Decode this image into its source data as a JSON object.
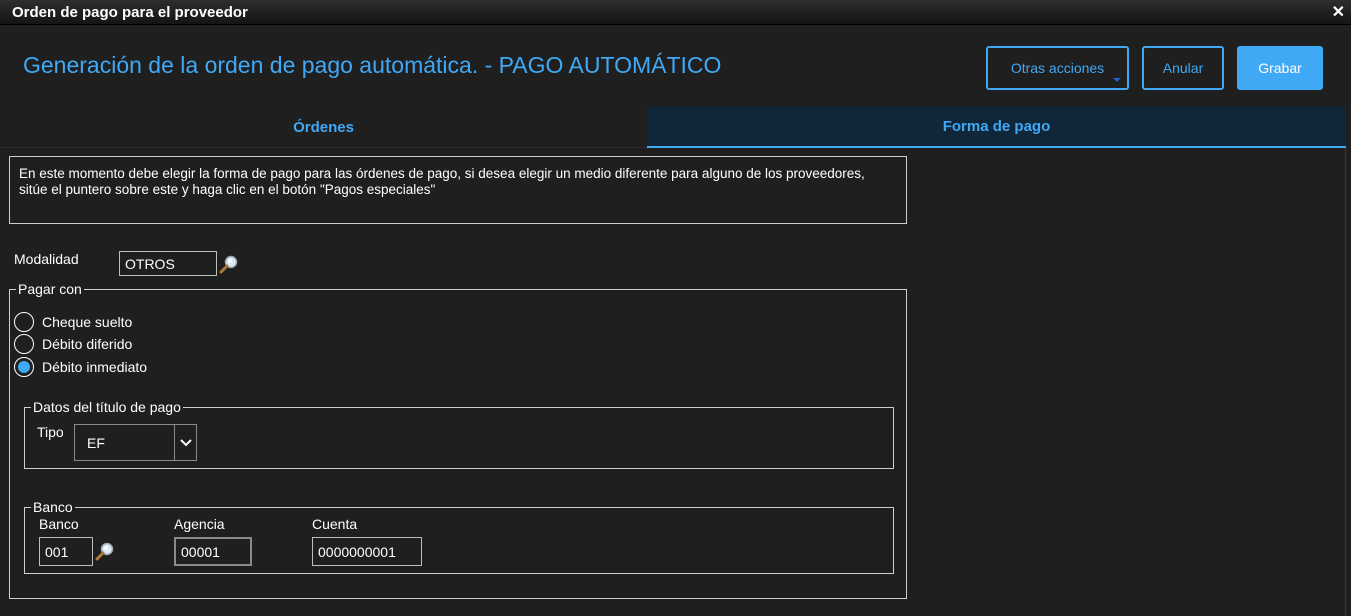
{
  "window": {
    "title": "Orden de pago para el proveedor",
    "close_icon": "close-icon"
  },
  "header": {
    "title": "Generación de la orden de pago automática. - PAGO AUTOMÁTICO",
    "buttons": {
      "more_actions": "Otras acciones",
      "cancel": "Anular",
      "save": "Grabar"
    }
  },
  "tabs": [
    {
      "label": "Órdenes",
      "active": false
    },
    {
      "label": "Forma de pago",
      "active": true
    }
  ],
  "info_text": "En este momento debe elegir la forma de pago para las órdenes de pago, si desea elegir un medio diferente para alguno de los proveedores, sitúe el puntero sobre este y haga clic en el botón \"Pagos especiales\"",
  "modalidad": {
    "label": "Modalidad",
    "value": "OTROS"
  },
  "pay_with": {
    "legend": "Pagar con",
    "options": [
      {
        "label": "Cheque suelto",
        "selected": false
      },
      {
        "label": "Débito diferido",
        "selected": false
      },
      {
        "label": "Débito inmediato",
        "selected": true
      }
    ]
  },
  "title_data": {
    "legend": "Datos del título de pago",
    "tipo_label": "Tipo",
    "tipo_value": "EF"
  },
  "bank": {
    "legend": "Banco",
    "banco_label": "Banco",
    "banco_value": "001",
    "agencia_label": "Agencia",
    "agencia_value": "00001",
    "cuenta_label": "Cuenta",
    "cuenta_value": "0000000001"
  },
  "colors": {
    "accent": "#3fa9f5",
    "background": "#1f1f1f",
    "active_tab": "#0f2738"
  }
}
